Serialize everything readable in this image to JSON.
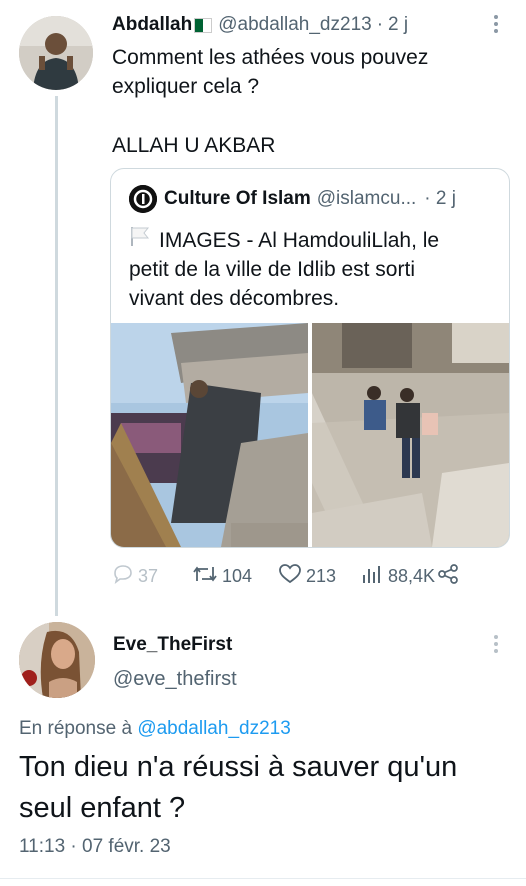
{
  "tweet": {
    "author_name": "Abdallah",
    "author_handle": "@abdallah_dz213",
    "separator": "·",
    "time": "2 j",
    "text_line1": "Comment les athées vous pouvez",
    "text_line2": "expliquer cela ?",
    "text_line3": "ALLAH U AKBAR",
    "flag_icon": "algeria-flag-icon"
  },
  "quoted": {
    "author_name": "Culture Of Islam",
    "author_handle": "@islamcu...",
    "time": "· 2 j",
    "text_line1": "IMAGES - Al HamdouliLlah, le",
    "text_line2": "petit  de la ville de Idlib est sorti",
    "text_line3": "vivant des décombres."
  },
  "actions": {
    "replies": "37",
    "retweets": "104",
    "likes": "213",
    "views": "88,4K"
  },
  "reply": {
    "author_name": "Eve_TheFirst",
    "author_handle": "@eve_thefirst",
    "in_reply_prefix": "En réponse à",
    "in_reply_handle": "@abdallah_dz213",
    "text_line1": "Ton dieu n'a réussi à sauver qu'un",
    "text_line2": "seul enfant ?",
    "timestamp": "11:13 · 07 févr. 23"
  },
  "colors": {
    "link": "#1d9bf0",
    "muted": "#536471",
    "border": "#cfd9de"
  }
}
